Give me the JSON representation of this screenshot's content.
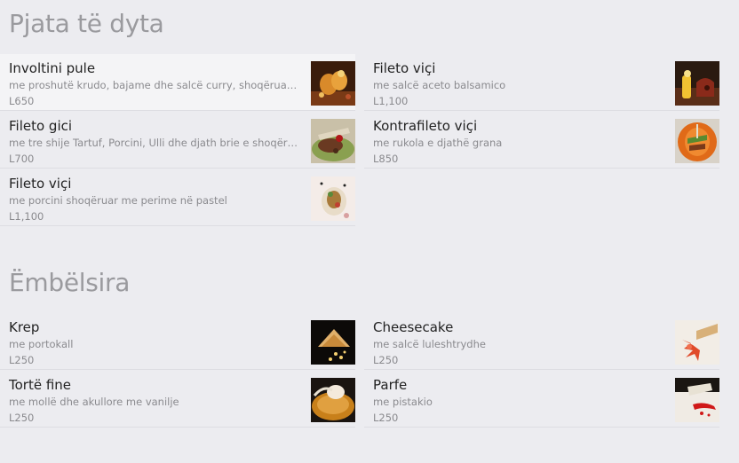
{
  "sections": [
    {
      "title": "Pjata të dyta",
      "items": [
        {
          "name": "Involtini pule",
          "desc": "me proshutë krudo, bajame dhe salcë curry, shoqëruar m...",
          "price": "L650",
          "image": "chicken-roll-photo"
        },
        {
          "name": "Fileto viçi",
          "desc": "me salcë aceto balsamico",
          "price": "L1,100",
          "image": "beef-fillet-photo"
        },
        {
          "name": "Fileto gici",
          "desc": "me tre shije Tartuf, Porcini, Ulli dhe djath brie e shoqëruar...",
          "price": "L700",
          "image": "pork-fillet-photo"
        },
        {
          "name": "Kontrafileto viçi",
          "desc": "me rukola e djathë grana",
          "price": "L850",
          "image": "beef-sirloin-photo"
        },
        {
          "name": "Fileto viçi",
          "desc": "me porcini shoqëruar me perime në pastel",
          "price": "L1,100",
          "image": "beef-porcini-photo"
        }
      ]
    },
    {
      "title": "Ëmbëlsira",
      "items": [
        {
          "name": "Krep",
          "desc": "me portokall",
          "price": "L250",
          "image": "crepe-photo"
        },
        {
          "name": "Cheesecake",
          "desc": "me salcë luleshtrydhe",
          "price": "L250",
          "image": "cheesecake-photo"
        },
        {
          "name": "Tortë fine",
          "desc": "me mollë dhe akullore me vanilje",
          "price": "L250",
          "image": "apple-tart-photo"
        },
        {
          "name": "Parfe",
          "desc": "me pistakio",
          "price": "L250",
          "image": "parfait-photo"
        }
      ]
    }
  ],
  "colors": {
    "background": "#ececf0",
    "highlight_row": "#f4f4f6",
    "section_title": "#9a9a9e",
    "item_name": "#222222",
    "item_meta": "#8a8a8e"
  }
}
